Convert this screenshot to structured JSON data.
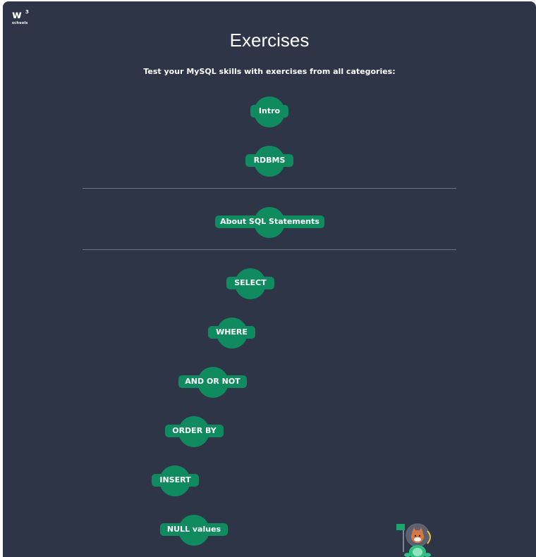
{
  "header": {
    "logo_text": "schools",
    "logo_letter": "w",
    "logo_sup": "3",
    "title": "Exercises",
    "subtitle": "Test your MySQL skills with exercises from all categories:"
  },
  "path": {
    "items": [
      {
        "label": "Intro"
      },
      {
        "label": "RDBMS"
      },
      {
        "label": "About SQL Statements"
      },
      {
        "label": "SELECT"
      },
      {
        "label": "WHERE"
      },
      {
        "label": "AND OR NOT"
      },
      {
        "label": "ORDER BY"
      },
      {
        "label": "INSERT"
      },
      {
        "label": "NULL values"
      }
    ]
  },
  "colors": {
    "background": "#2d3546",
    "node": "#0f8b5f",
    "text": "#ffffff"
  }
}
